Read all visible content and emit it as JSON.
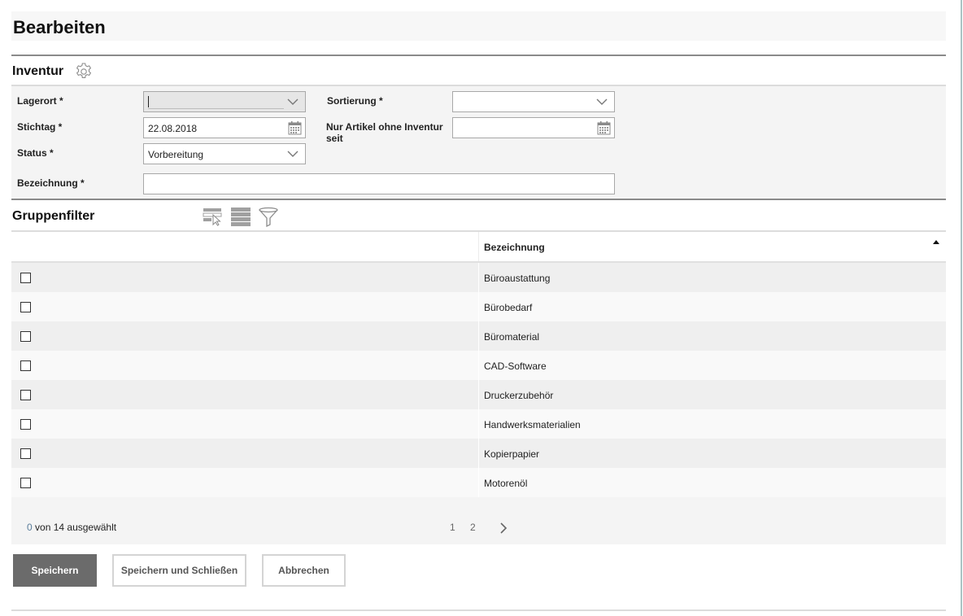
{
  "page": {
    "title": "Bearbeiten"
  },
  "inventur": {
    "section_title": "Inventur",
    "settings_icon": "gear-icon",
    "fields": {
      "lagerort": {
        "label": "Lagerort *",
        "value": ""
      },
      "stichtag": {
        "label": "Stichtag *",
        "value": "22.08.2018"
      },
      "status": {
        "label": "Status *",
        "value": "Vorbereitung"
      },
      "bezeichnung": {
        "label": "Bezeichnung *",
        "value": ""
      },
      "sortierung": {
        "label": "Sortierung *",
        "value": ""
      },
      "nur_artikel": {
        "label_line1": "Nur Artikel ohne Inventur",
        "label_line2": "seit",
        "value": ""
      }
    }
  },
  "gruppenfilter": {
    "section_title": "Gruppenfilter",
    "toolbar_icons": [
      "select-rows-icon",
      "list-view-icon",
      "filter-icon"
    ],
    "column_header": "Bezeichnung",
    "sort": "ascending",
    "rows": [
      {
        "label": "Büroaustattung",
        "checked": false
      },
      {
        "label": "Bürobedarf",
        "checked": false
      },
      {
        "label": "Büromaterial",
        "checked": false
      },
      {
        "label": "CAD-Software",
        "checked": false
      },
      {
        "label": "Druckerzubehör",
        "checked": false
      },
      {
        "label": "Handwerksmaterialien",
        "checked": false
      },
      {
        "label": "Kopierpapier",
        "checked": false
      },
      {
        "label": "Motorenöl",
        "checked": false
      }
    ],
    "selection": {
      "count": "0",
      "suffix": "von 14 ausgewählt"
    },
    "pager": {
      "pages": [
        "1",
        "2"
      ],
      "current": "1"
    }
  },
  "actions": {
    "save": "Speichern",
    "save_close": "Speichern und Schließen",
    "cancel": "Abbrechen"
  },
  "colors": {
    "primary_button": "#6b6b6b",
    "selection_count": "#5a7d9a",
    "accent_line": "#a9c3c3"
  }
}
